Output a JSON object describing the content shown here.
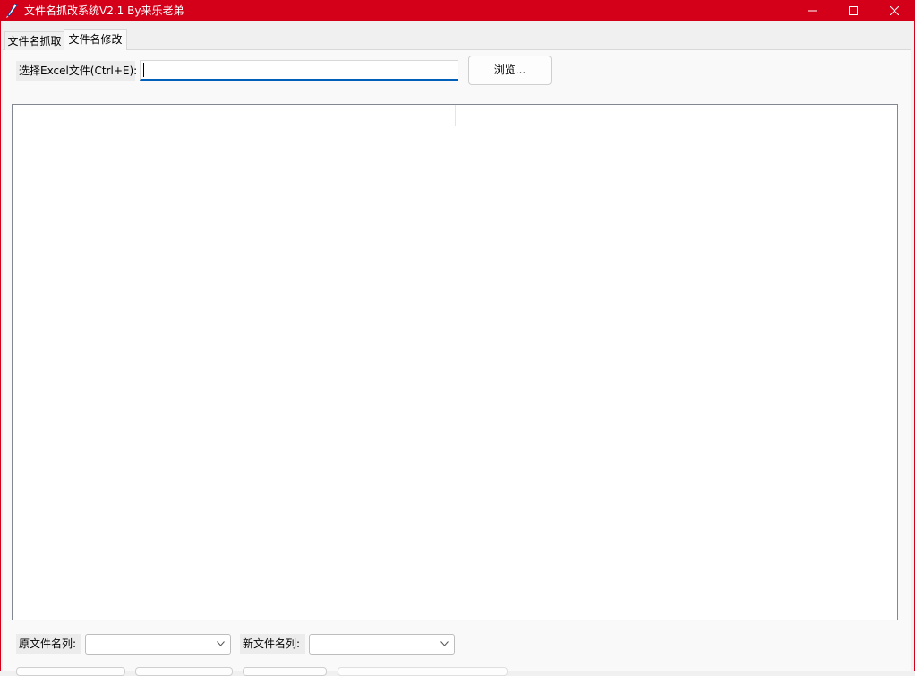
{
  "window": {
    "title": "文件名抓改系统V2.1 By来乐老弟"
  },
  "tabs": [
    {
      "label": "文件名抓取"
    },
    {
      "label": "文件名修改"
    }
  ],
  "excel": {
    "label": "选择Excel文件(Ctrl+E):",
    "path_value": "",
    "browse_label": "浏览..."
  },
  "columns": {
    "original_label": "原文件名列:",
    "original_value": "",
    "new_label": "新文件名列:",
    "new_value": ""
  },
  "icons": {
    "app": "feather-pen-icon",
    "minimize": "minimize-icon",
    "maximize": "maximize-icon",
    "close": "close-icon",
    "dropdown": "chevron-down-icon"
  },
  "colors": {
    "titlebar": "#d4001a",
    "focus_underline": "#005fb8"
  }
}
